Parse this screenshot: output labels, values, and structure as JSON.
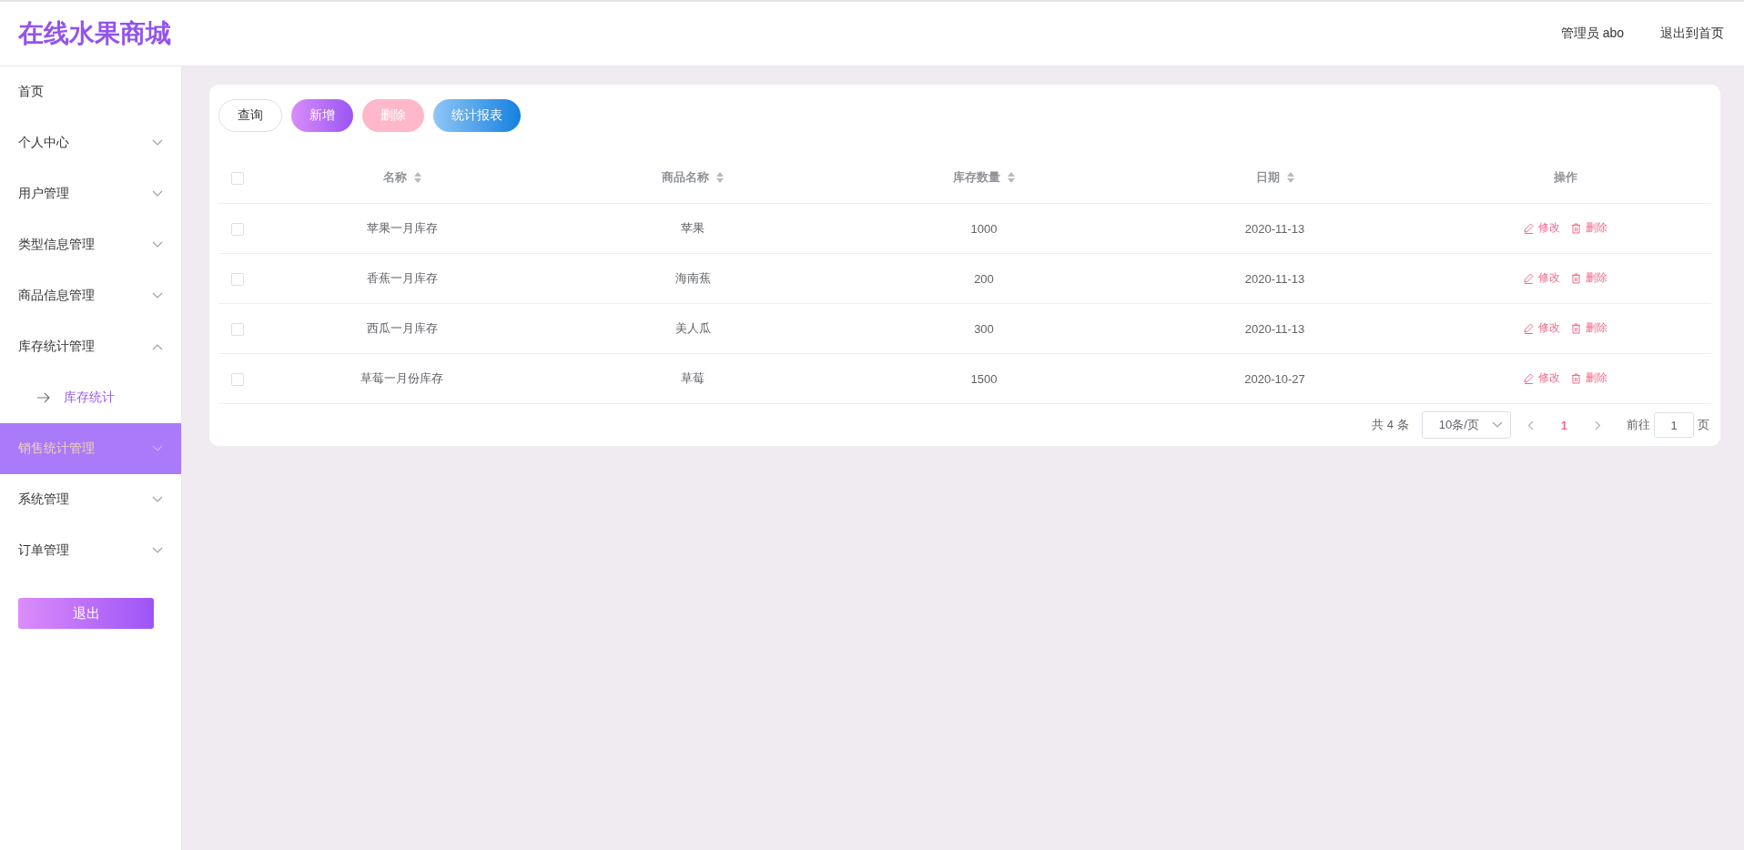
{
  "header": {
    "title": "在线水果商城",
    "user": "管理员 abo",
    "exit_link": "退出到首页"
  },
  "sidebar": {
    "items": [
      {
        "label": "首页",
        "kind": "link",
        "selected": false
      },
      {
        "label": "个人中心",
        "kind": "submenu",
        "expanded": false,
        "selected": false
      },
      {
        "label": "用户管理",
        "kind": "submenu",
        "expanded": false,
        "selected": false
      },
      {
        "label": "类型信息管理",
        "kind": "submenu",
        "expanded": false,
        "selected": false
      },
      {
        "label": "商品信息管理",
        "kind": "submenu",
        "expanded": false,
        "selected": false
      },
      {
        "label": "库存统计管理",
        "kind": "submenu",
        "expanded": true,
        "selected": false,
        "children": [
          {
            "label": "库存统计",
            "selected": true
          }
        ]
      },
      {
        "label": "销售统计管理",
        "kind": "submenu",
        "expanded": false,
        "selected": true
      },
      {
        "label": "系统管理",
        "kind": "submenu",
        "expanded": false,
        "selected": false
      },
      {
        "label": "订单管理",
        "kind": "submenu",
        "expanded": false,
        "selected": false
      }
    ],
    "logout_button": "退出"
  },
  "toolbar": [
    {
      "label": "查询",
      "kind": "query",
      "disabled": false
    },
    {
      "label": "新增",
      "kind": "add",
      "disabled": false
    },
    {
      "label": "删除",
      "kind": "delete",
      "disabled": true
    },
    {
      "label": "统计报表",
      "kind": "report",
      "disabled": false
    }
  ],
  "table": {
    "select_all": {
      "checked": false
    },
    "columns": [
      {
        "label": "名称",
        "sortable": true
      },
      {
        "label": "商品名称",
        "sortable": true
      },
      {
        "label": "库存数量",
        "sortable": true
      },
      {
        "label": "日期",
        "sortable": true
      },
      {
        "label": "操作",
        "sortable": false
      }
    ],
    "rows": [
      {
        "checked": false,
        "cells": [
          "苹果一月库存",
          "苹果",
          "1000",
          "2020-11-13"
        ],
        "actions": [
          {
            "label": "修改",
            "kind": "edit"
          },
          {
            "label": "删除",
            "kind": "delete"
          }
        ]
      },
      {
        "checked": false,
        "cells": [
          "香蕉一月库存",
          "海南蕉",
          "200",
          "2020-11-13"
        ],
        "actions": [
          {
            "label": "修改",
            "kind": "edit"
          },
          {
            "label": "删除",
            "kind": "delete"
          }
        ]
      },
      {
        "checked": false,
        "cells": [
          "西瓜一月库存",
          "美人瓜",
          "300",
          "2020-11-13"
        ],
        "actions": [
          {
            "label": "修改",
            "kind": "edit"
          },
          {
            "label": "删除",
            "kind": "delete"
          }
        ]
      },
      {
        "checked": false,
        "cells": [
          "草莓一月份库存",
          "草莓",
          "1500",
          "2020-10-27"
        ],
        "actions": [
          {
            "label": "修改",
            "kind": "edit"
          },
          {
            "label": "删除",
            "kind": "delete"
          }
        ]
      }
    ]
  },
  "pagination": {
    "total": "共 4 条",
    "page_size": "10条/页",
    "pages": [
      {
        "label": "1",
        "selected": true
      }
    ],
    "goto_label": "前往",
    "goto_value": "1",
    "page_suffix": "页"
  }
}
